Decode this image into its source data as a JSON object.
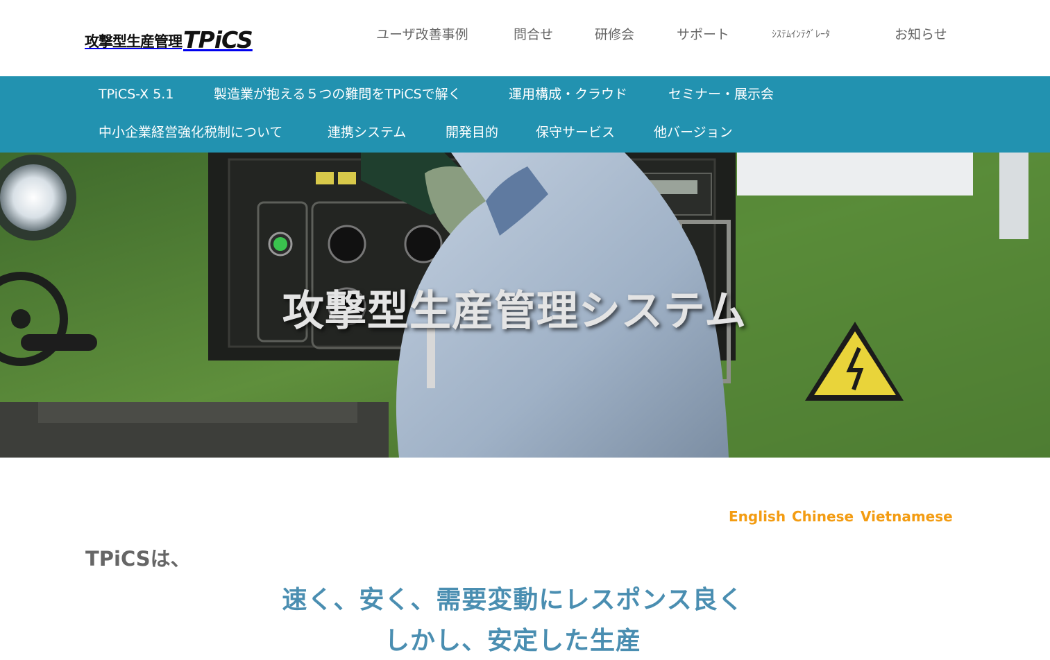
{
  "logo": {
    "jp": "攻撃型生産管理",
    "brand": "TPiCS"
  },
  "top_nav": [
    "ユーザ改善事例",
    "問合せ",
    "研修会",
    "サポート",
    "ｼｽﾃﾑｲﾝﾃｸﾞﾚｰﾀ",
    "お知らせ"
  ],
  "main_nav": {
    "row1": [
      "TPiCS-X 5.1",
      "製造業が抱える５つの難問をTPiCSで解く",
      "運用構成・クラウド",
      "セミナー・展示会"
    ],
    "row2": [
      "中小企業経営強化税制について",
      "連携システム",
      "開発目的",
      "保守サービス",
      "他バージョン"
    ]
  },
  "hero": {
    "title": "攻撃型生産管理システム"
  },
  "languages": [
    "English",
    "Chinese",
    "Vietnamese"
  ],
  "intro": "TPiCSは、",
  "tagline": [
    "速く、安く、需要変動にレスポンス良く",
    "しかし、安定した生産"
  ],
  "colors": {
    "band": "#2292b0",
    "accent": "#f39c12",
    "tagline": "#4a8eb1"
  }
}
